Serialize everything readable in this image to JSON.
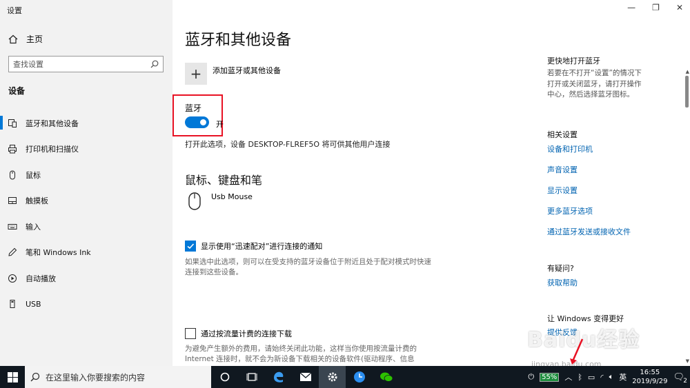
{
  "window": {
    "title": "设置"
  },
  "sidebar": {
    "home_label": "主页",
    "search_placeholder": "查找设置",
    "section_label": "设备",
    "items": [
      {
        "label": "蓝牙和其他设备",
        "icon": "bluetooth-devices-icon",
        "active": true
      },
      {
        "label": "打印机和扫描仪",
        "icon": "printer-icon",
        "active": false
      },
      {
        "label": "鼠标",
        "icon": "mouse-icon",
        "active": false
      },
      {
        "label": "触摸板",
        "icon": "touchpad-icon",
        "active": false
      },
      {
        "label": "输入",
        "icon": "keyboard-icon",
        "active": false
      },
      {
        "label": "笔和 Windows Ink",
        "icon": "pen-icon",
        "active": false
      },
      {
        "label": "自动播放",
        "icon": "autoplay-icon",
        "active": false
      },
      {
        "label": "USB",
        "icon": "usb-icon",
        "active": false
      }
    ]
  },
  "main": {
    "title": "蓝牙和其他设备",
    "add_device_label": "添加蓝牙或其他设备",
    "bluetooth": {
      "label": "蓝牙",
      "state_label": "开",
      "on": true,
      "discoverable_text": "打开此选项，设备 DESKTOP-FLREF5O 将可供其他用户连接"
    },
    "peripherals": {
      "title": "鼠标、键盘和笔",
      "devices": [
        {
          "name": "Usb Mouse",
          "icon": "mouse-device-icon"
        }
      ]
    },
    "swift_pair": {
      "label": "显示使用“迅速配对”进行连接的通知",
      "checked": true,
      "description": "如果选中此选项，则可以在受支持的蓝牙设备位于附近且处于配对模式时快速连接到这些设备。"
    },
    "metered": {
      "label": "通过按流量计费的连接下载",
      "checked": false,
      "description": "为避免产生额外的费用，请始终关闭此功能，这样当你使用按流量计费的 Internet 连接时，就不会为新设备下载相关的设备软件(驱动程序、信息"
    }
  },
  "right_panel": {
    "quick_open": {
      "title": "更快地打开蓝牙",
      "text": "若要在不打开“设置”的情况下打开或关闭蓝牙，请打开操作中心，然后选择蓝牙图标。"
    },
    "related": {
      "title": "相关设置",
      "links": [
        "设备和打印机",
        "声音设置",
        "显示设置",
        "更多蓝牙选项",
        "通过蓝牙发送或接收文件"
      ]
    },
    "help": {
      "title": "有疑问?",
      "link": "获取帮助"
    },
    "feedback": {
      "title": "让 Windows 变得更好",
      "link": "提供反馈"
    }
  },
  "watermark": {
    "brand": "Baidu经验",
    "url": "jingyan.baidu.com"
  },
  "taskbar": {
    "search_placeholder": "在这里输入你要搜索的内容",
    "battery_percent": "55%",
    "ime": "英",
    "time": "16:55",
    "date": "2019/9/29",
    "notifications_count": "2"
  },
  "colors": {
    "accent": "#0078d7",
    "highlight": "#e81123",
    "link": "#0063b1",
    "taskbar": "#101820"
  }
}
